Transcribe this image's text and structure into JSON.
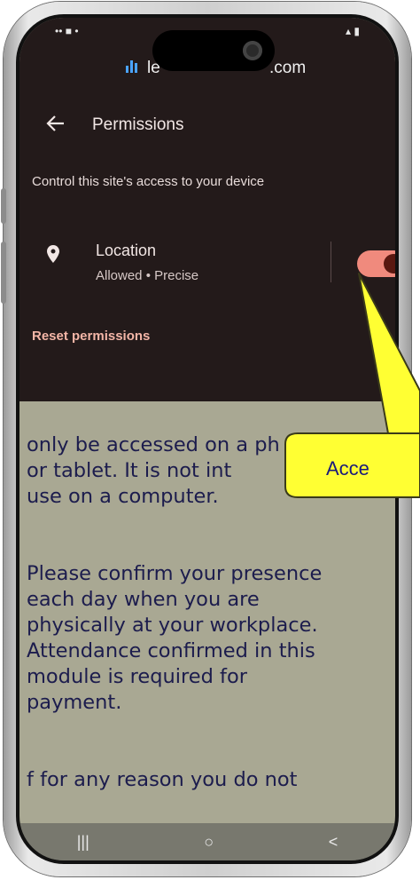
{
  "status_bar": {
    "left_icons": "•• ■ •",
    "right_icons": "▴ ▮"
  },
  "browser": {
    "url_prefix": "le",
    "url_suffix": ".com"
  },
  "permissions": {
    "title": "Permissions",
    "description": "Control this site's access to your device",
    "location": {
      "label": "Location",
      "status": "Allowed • Precise",
      "enabled": true
    },
    "reset_label": "Reset permissions"
  },
  "webpage": {
    "para1": "only be accessed on a ph\nor tablet. It is not int\nuse on a computer.",
    "para2": "Please confirm your presence\neach day when you are\nphysically at your workplace.\nAttendance confirmed in this\nmodule is required for\npayment.",
    "para3": "f  for any reason you do not"
  },
  "nav": {
    "recent": "|||",
    "home": "○",
    "back": "<"
  },
  "callout": {
    "text": "Acce"
  },
  "colors": {
    "sheet_bg": "#231a1a",
    "toggle_on": "#f08a7d",
    "reset": "#f4b6a7",
    "callout": "#ffff33"
  }
}
